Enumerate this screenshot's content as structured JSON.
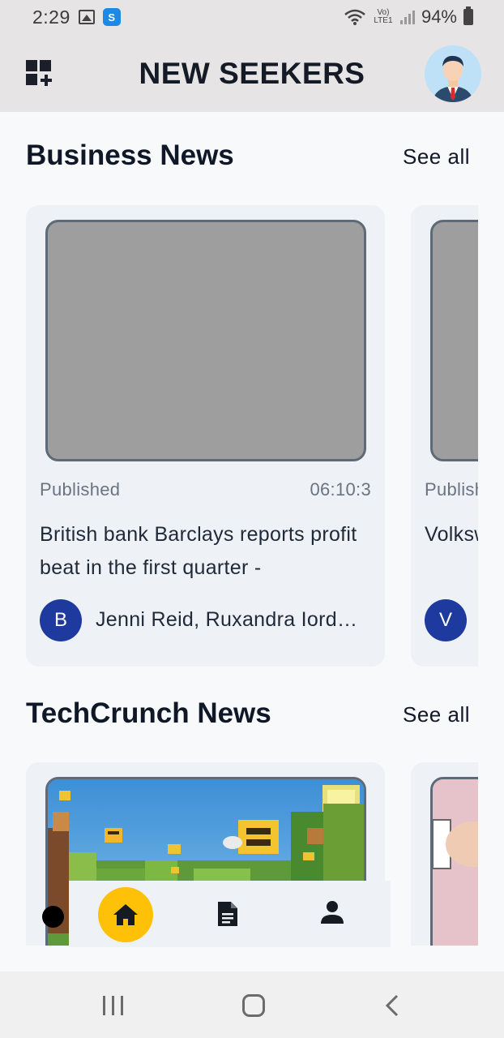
{
  "status_bar": {
    "time": "2:29",
    "network_label": "Vo) LTE1",
    "battery": "94%"
  },
  "app_bar": {
    "title": "NEW SEEKERS"
  },
  "sections": [
    {
      "title": "Business News",
      "see_all": "See all",
      "cards": [
        {
          "published_label": "Published",
          "time": "06:10:3",
          "headline": "British bank Barclays reports profit beat in the first quarter -",
          "author_initial": "B",
          "author": "Jenni Reid, Ruxandra Iordache"
        },
        {
          "published_label": "Published",
          "headline": "Volkswagen first-quarter",
          "author_initial": "V"
        }
      ]
    },
    {
      "title": "TechCrunch News",
      "see_all": "See all"
    }
  ],
  "colors": {
    "app_bar_bg": "#e6e4e4",
    "card_bg": "#eef2f7",
    "author_badge": "#1e3a9f",
    "nav_active": "#fec107"
  },
  "icons": {
    "app_bar_left": "grid-add-icon",
    "app_bar_right": "profile-avatar",
    "nav": [
      "home-icon",
      "document-icon",
      "person-icon"
    ],
    "system_nav": [
      "recents-icon",
      "home-outline-icon",
      "back-icon"
    ]
  }
}
